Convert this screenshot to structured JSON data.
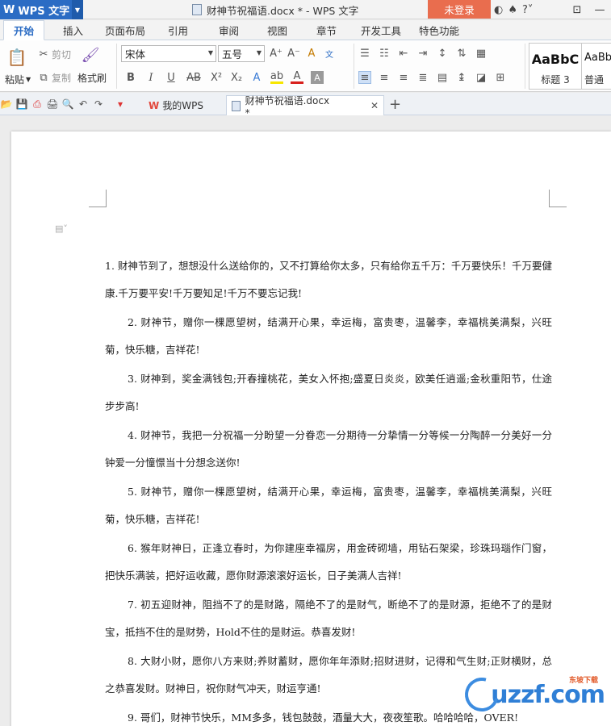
{
  "app": {
    "name": "WPS 文字",
    "window_title": "财神节祝福语.docx * - WPS 文字",
    "login": "未登录"
  },
  "menu": {
    "tabs": [
      "开始",
      "插入",
      "页面布局",
      "引用",
      "审阅",
      "视图",
      "章节",
      "开发工具",
      "特色功能"
    ]
  },
  "ribbon": {
    "paste": "粘贴",
    "cut": "剪切",
    "copy": "复制",
    "format_painter": "格式刷",
    "font_name": "宋体",
    "font_size": "五号",
    "styles": [
      {
        "preview": "AaBbC",
        "name": "标题 3"
      },
      {
        "preview": "AaBb",
        "name": "普通(网"
      }
    ]
  },
  "tabs": {
    "home": "我的WPS",
    "doc": "财神节祝福语.docx *"
  },
  "document": {
    "paragraphs": [
      "1. 财神节到了，想想没什么送给你的，又不打算给你太多，只有给你五千万：千万要快乐！千万要健康.千万要平安!千万要知足!千万不要忘记我!",
      "2. 财神节，赠你一棵愿望树，结满开心果，幸运梅，富贵枣，温馨李，幸福桃美满梨，兴旺菊，快乐糖，吉祥花!",
      "3. 财神到，奖金满钱包;开春撞桃花，美女入怀抱;盛夏日炎炎，欧美任逍遥;金秋重阳节，仕途步步高!",
      "4. 财神节，我把一分祝福一分盼望一分眷恋一分期待一分挚情一分等候一分陶醉一分美好一分钟爱一分憧憬当十分想念送你!",
      "5. 财神节，赠你一棵愿望树，结满开心果，幸运梅，富贵枣，温馨李，幸福桃美满梨，兴旺菊，快乐糖，吉祥花!",
      "6. 猴年财神日，正逢立春时，为你建座幸福房，用金砖砌墙，用钻石架梁，珍珠玛瑙作门窗，把快乐满装，把好运收藏，愿你财源滚滚好运长，日子美满人吉祥!",
      "7. 初五迎财神，阻挡不了的是财路，隔绝不了的是财气，断绝不了的是财源，拒绝不了的是财宝，抵挡不住的是财势，Hold不住的是财运。恭喜发财!",
      "8. 大财小财，愿你八方来财;养财蓄财，愿你年年添财;招财进财，记得和气生财;正财横财，总之恭喜发财。财神日，祝你财气冲天，财运亨通!",
      "9. 哥们，财神节快乐，MM多多，钱包鼓鼓，酒量大大，夜夜笙歌。哈哈哈哈，OVER!"
    ]
  },
  "watermark": {
    "brand": "uzzf.com",
    "tagline": "东坡下载"
  }
}
